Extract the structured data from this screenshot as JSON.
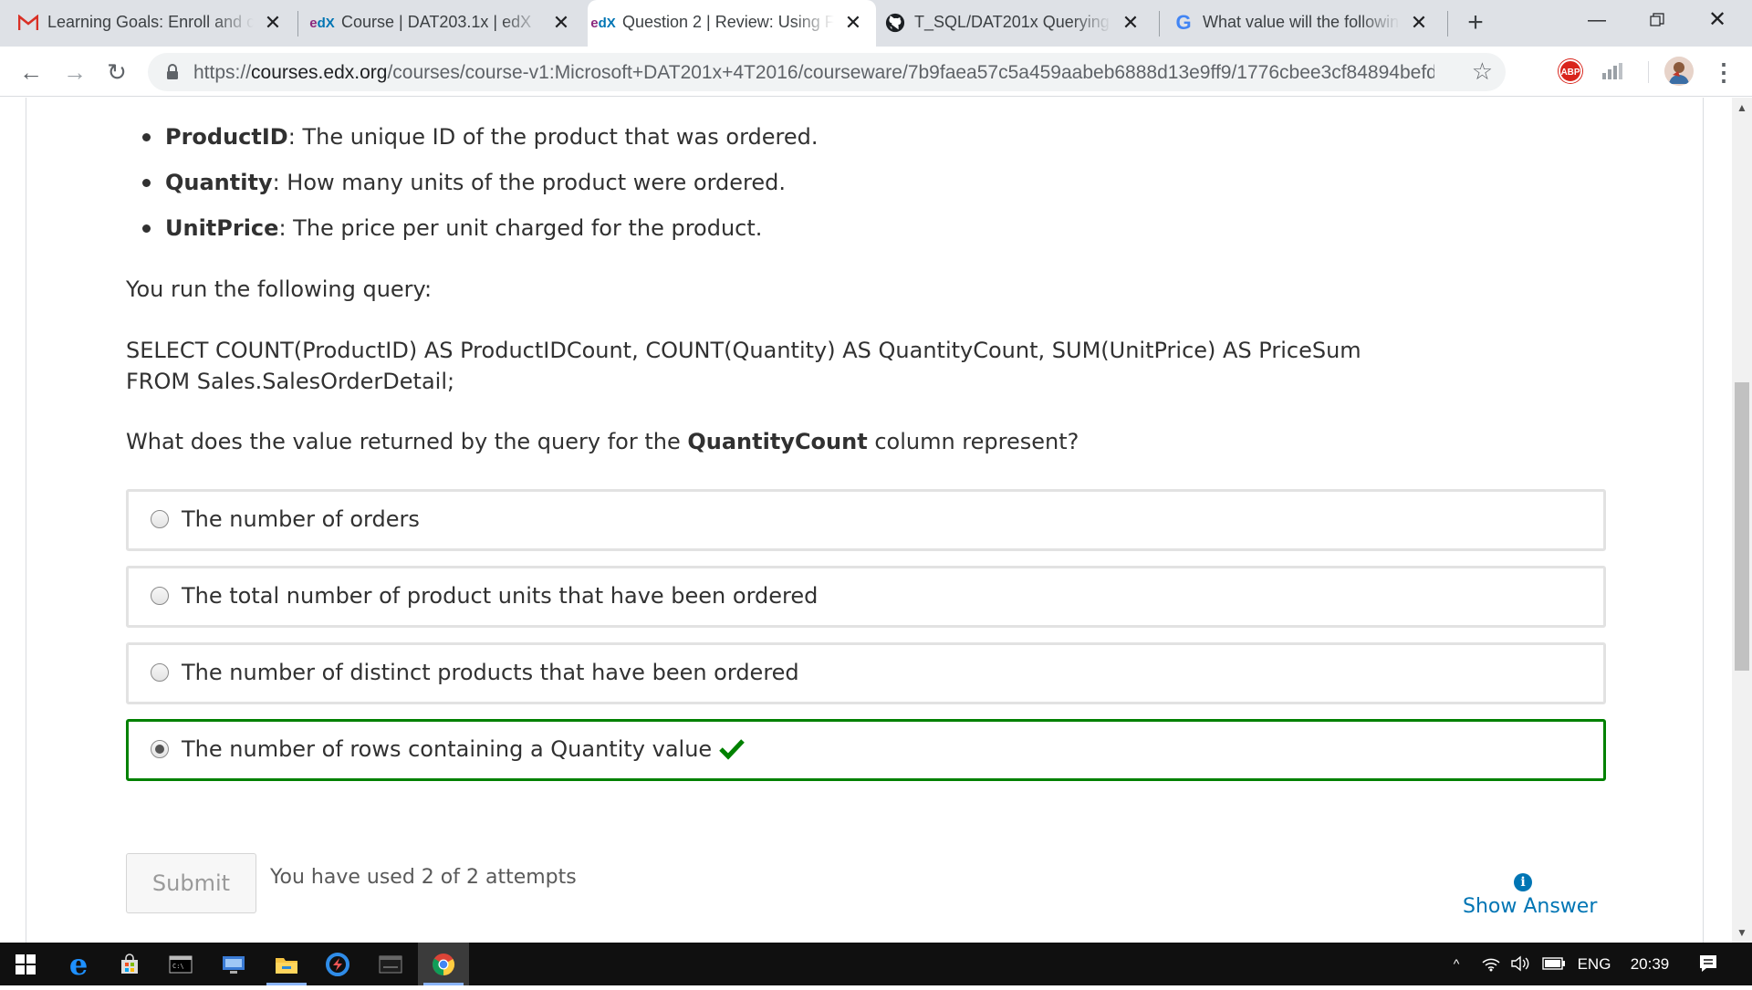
{
  "browser": {
    "tabs": [
      {
        "title": "Learning Goals: Enroll and c",
        "favicon": "gmail-icon",
        "active": false
      },
      {
        "title": "Course | DAT203.1x | edX",
        "favicon": "edx-icon",
        "active": false
      },
      {
        "title": "Question 2 | Review: Using F",
        "favicon": "edx-icon",
        "active": true
      },
      {
        "title": "T_SQL/DAT201x Querying w",
        "favicon": "github-icon",
        "active": false
      },
      {
        "title": "What value will the followin",
        "favicon": "google-icon",
        "active": false
      }
    ],
    "new_tab_label": "+",
    "url_scheme": "https://",
    "url_host": "courses.edx.org",
    "url_path": "/courses/course-v1:Microsoft+DAT201x+4T2016/courseware/7b9faea57c5a459aabeb6888d13e9ff9/1776cbee3cf84894befd5dd...",
    "abp_label": "ABP"
  },
  "question": {
    "bullets": [
      {
        "term": "ProductID",
        "desc": ": The unique ID of the product that was ordered."
      },
      {
        "term": "Quantity",
        "desc": ": How many units of the product were ordered."
      },
      {
        "term": "UnitPrice",
        "desc": ": The price per unit charged for the product."
      }
    ],
    "run_query_text": "You run the following query:",
    "query_line1": "SELECT COUNT(ProductID) AS ProductIDCount, COUNT(Quantity) AS QuantityCount, SUM(UnitPrice) AS PriceSum",
    "query_line2": "FROM Sales.SalesOrderDetail;",
    "prompt_before": "What does the value returned by the query for the ",
    "prompt_bold": "QuantityCount",
    "prompt_after": " column represent?",
    "options": [
      {
        "label": "The number of orders",
        "selected": false,
        "correct": false
      },
      {
        "label": "The total number of product units that have been ordered",
        "selected": false,
        "correct": false
      },
      {
        "label": "The number of distinct products that have been ordered",
        "selected": false,
        "correct": false
      },
      {
        "label": "The number of rows containing a Quantity value",
        "selected": true,
        "correct": true
      }
    ],
    "submit_label": "Submit",
    "attempts_text": "You have used 2 of 2 attempts",
    "show_answer_label": "Show Answer"
  },
  "taskbar": {
    "language": "ENG",
    "time": "20:39"
  },
  "colors": {
    "correct_border": "#008100",
    "link": "#0075b4",
    "abp_red": "#d9251c"
  }
}
